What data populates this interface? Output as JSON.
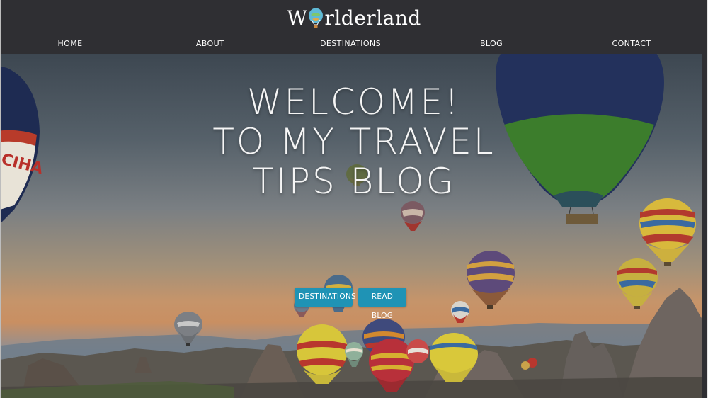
{
  "brand": {
    "logo_prefix": "W",
    "logo_suffix": "rlderland"
  },
  "nav": {
    "items": [
      {
        "label": "HOME"
      },
      {
        "label": "ABOUT"
      },
      {
        "label": "DESTINATIONS"
      },
      {
        "label": "BLOG"
      },
      {
        "label": "CONTACT"
      }
    ]
  },
  "hero": {
    "title_lines": [
      "WELCOME!",
      "TO MY TRAVEL",
      "TIPS BLOG"
    ],
    "buttons": [
      {
        "label": "DESTINATIONS"
      },
      {
        "label": "READ BLOG"
      }
    ],
    "balloon_sign": "CIHA"
  },
  "colors": {
    "header_bg": "#2f2f33",
    "button_bg": "#1f93b5",
    "text": "#ffffff"
  }
}
